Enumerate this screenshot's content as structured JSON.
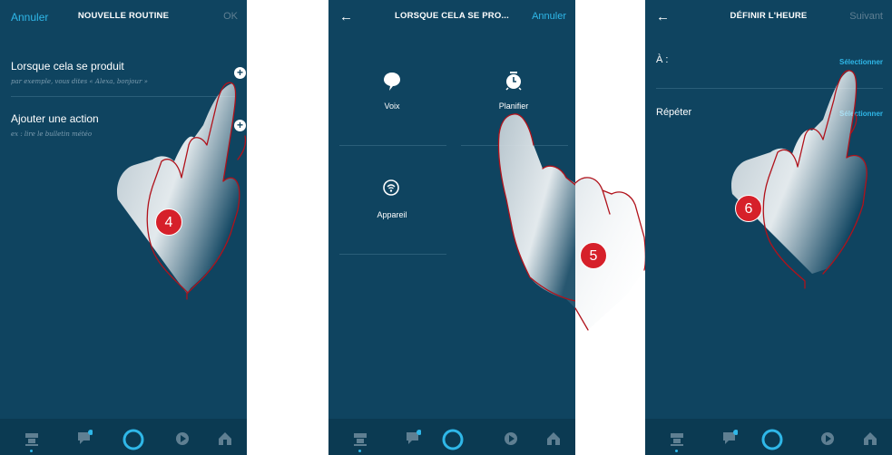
{
  "colors": {
    "panel_bg": "#0f4460",
    "accent": "#2fb7e8",
    "badge": "#d6202a",
    "hand_outline": "#b0121b"
  },
  "panel1": {
    "top_bar": {
      "left": "Annuler",
      "title": "NOUVELLE ROUTINE",
      "right": "OK"
    },
    "rows": [
      {
        "title": "Lorsque cela se produit",
        "subtitle": "par exemple, vous dites « Alexa, bonjour »",
        "icon": "plus-circle-icon"
      },
      {
        "title": "Ajouter une action",
        "subtitle": "ex : lire le bulletin météo",
        "icon": "plus-circle-icon"
      }
    ],
    "step_badge": "4"
  },
  "panel2": {
    "top_bar": {
      "left_icon": "back-arrow-icon",
      "left": "←",
      "title": "LORSQUE CELA SE PRO...",
      "right": "Annuler"
    },
    "options": [
      {
        "label": "Voix",
        "icon": "speech-bubble-icon"
      },
      {
        "label": "Planifier",
        "icon": "alarm-clock-icon"
      },
      {
        "label": "Appareil",
        "icon": "wifi-device-icon"
      }
    ],
    "step_badge": "5"
  },
  "panel3": {
    "top_bar": {
      "left_icon": "back-arrow-icon",
      "left": "←",
      "title": "DÉFINIR L'HEURE",
      "right": "Suivant"
    },
    "rows": [
      {
        "label": "À :",
        "action": "Sélectionner"
      },
      {
        "label": "Répéter",
        "action": "Sélectionner"
      }
    ],
    "step_badge": "6"
  },
  "bottom_nav": [
    {
      "icon": "home-devices-icon"
    },
    {
      "icon": "chat-bubble-icon"
    },
    {
      "icon": "alexa-ring-icon",
      "active": true
    },
    {
      "icon": "play-icon"
    },
    {
      "icon": "smart-home-icon"
    }
  ]
}
